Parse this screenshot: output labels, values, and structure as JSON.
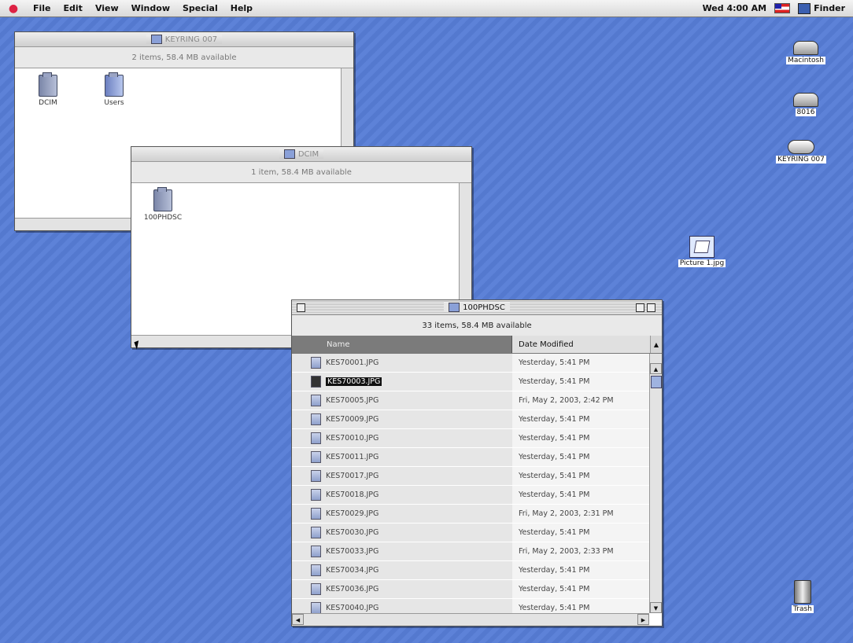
{
  "menubar": {
    "items": [
      "File",
      "Edit",
      "View",
      "Window",
      "Special",
      "Help"
    ],
    "clock": "Wed 4:00 AM",
    "app": "Finder"
  },
  "windows": {
    "keyring": {
      "title": "KEYRING 007",
      "info": "2 items, 58.4 MB available",
      "items": [
        "DCIM",
        "Users"
      ]
    },
    "dcim": {
      "title": "DCIM",
      "info": "1 item, 58.4 MB available",
      "items": [
        "100PHDSC"
      ]
    },
    "phdsc": {
      "title": "100PHDSC",
      "info": "33 items, 58.4 MB available",
      "col_name": "Name",
      "col_date": "Date Modified",
      "rows": [
        {
          "name": "KES70001.JPG",
          "date": "Yesterday, 5:41 PM"
        },
        {
          "name": "KES70003.JPG",
          "date": "Yesterday, 5:41 PM"
        },
        {
          "name": "KES70005.JPG",
          "date": "Fri, May 2, 2003, 2:42 PM"
        },
        {
          "name": "KES70009.JPG",
          "date": "Yesterday, 5:41 PM"
        },
        {
          "name": "KES70010.JPG",
          "date": "Yesterday, 5:41 PM"
        },
        {
          "name": "KES70011.JPG",
          "date": "Yesterday, 5:41 PM"
        },
        {
          "name": "KES70017.JPG",
          "date": "Yesterday, 5:41 PM"
        },
        {
          "name": "KES70018.JPG",
          "date": "Yesterday, 5:41 PM"
        },
        {
          "name": "KES70029.JPG",
          "date": "Fri, May 2, 2003, 2:31 PM"
        },
        {
          "name": "KES70030.JPG",
          "date": "Yesterday, 5:41 PM"
        },
        {
          "name": "KES70033.JPG",
          "date": "Fri, May 2, 2003, 2:33 PM"
        },
        {
          "name": "KES70034.JPG",
          "date": "Yesterday, 5:41 PM"
        },
        {
          "name": "KES70036.JPG",
          "date": "Yesterday, 5:41 PM"
        },
        {
          "name": "KES70040.JPG",
          "date": "Yesterday, 5:41 PM"
        }
      ]
    }
  },
  "desktop_icons": {
    "macintosh": "Macintosh",
    "disk2": "8016",
    "keyring": "KEYRING 007",
    "picture": "Picture 1.jpg",
    "trash": "Trash"
  }
}
